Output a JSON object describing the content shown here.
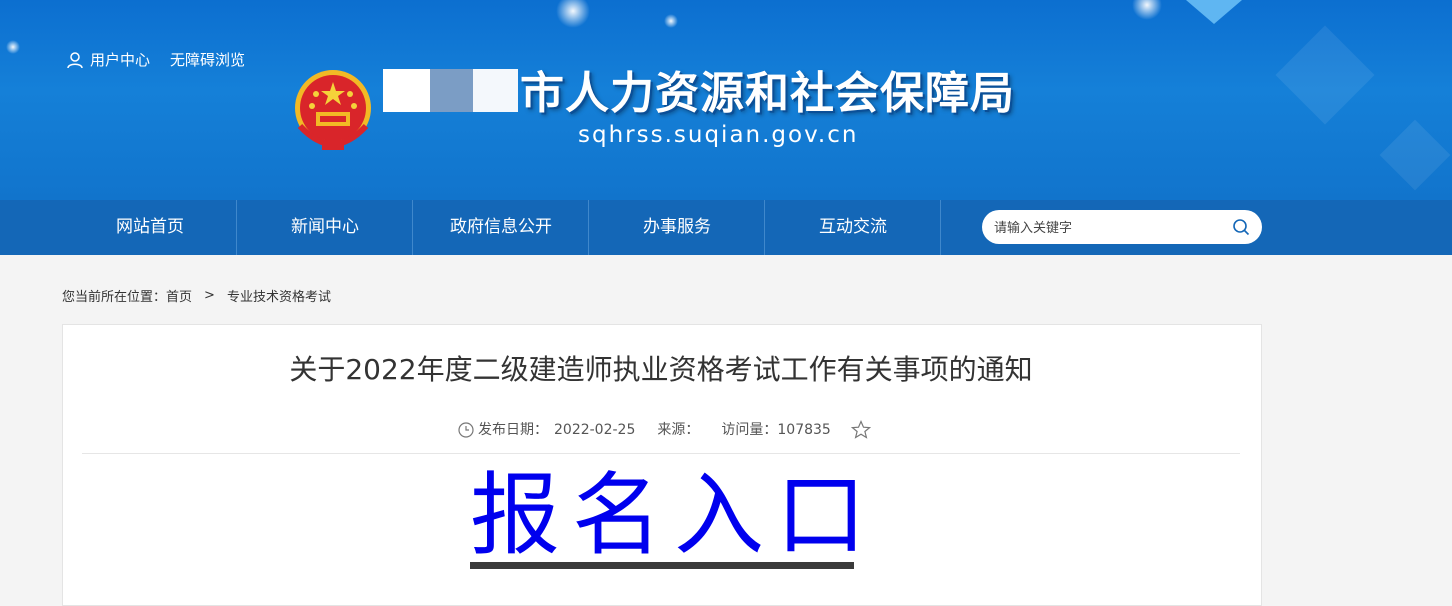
{
  "header": {
    "user_center": "用户中心",
    "accessibility": "无障碍浏览",
    "site_title": "市人力资源和社会保障局",
    "site_domain": "sqhrss.suqian.gov.cn"
  },
  "nav": {
    "items": [
      "网站首页",
      "新闻中心",
      "政府信息公开",
      "办事服务",
      "互动交流"
    ],
    "search_placeholder": "请输入关键字"
  },
  "breadcrumb": {
    "prefix": "您当前所在位置：",
    "home": "首页",
    "separator": ">",
    "current": "专业技术资格考试"
  },
  "article": {
    "title": "关于2022年度二级建造师执业资格考试工作有关事项的通知",
    "date_label": "发布日期：",
    "date": "2022-02-25",
    "source_label": "来源：",
    "views_label": "访问量：",
    "views": "107835",
    "register_link": "报名入口"
  },
  "colors": {
    "banner": "#1580d8",
    "nav": "#1467b7",
    "link": "#0000ee"
  }
}
